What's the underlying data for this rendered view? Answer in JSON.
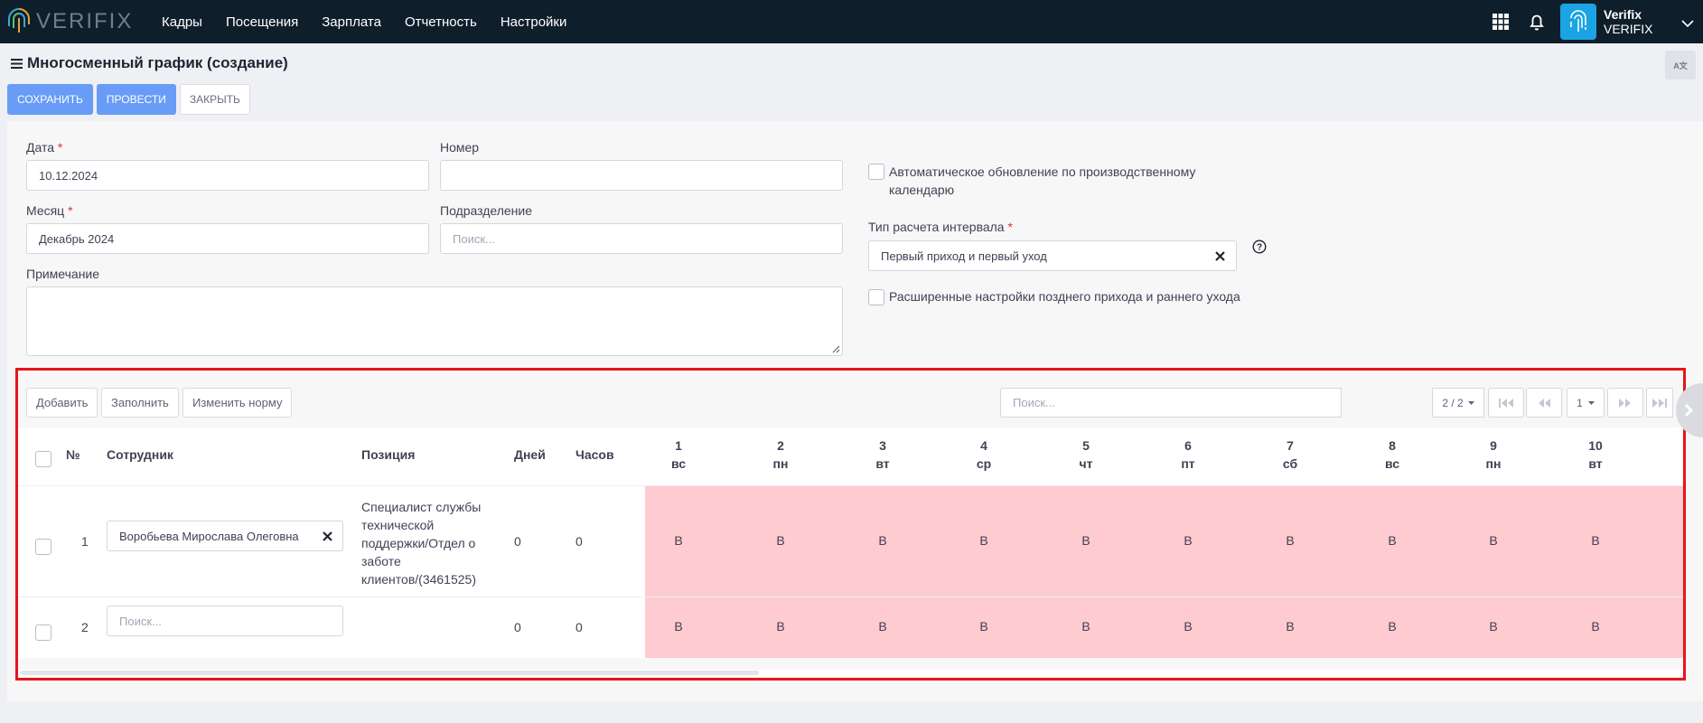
{
  "topbar": {
    "logo_text": "VERIFIX",
    "nav": [
      "Кадры",
      "Посещения",
      "Зарплата",
      "Отчетность",
      "Настройки"
    ],
    "user": {
      "name": "Verifix",
      "org": "VERIFIX"
    }
  },
  "page": {
    "title": "Многосменный график (создание)",
    "lang_badge": "A文"
  },
  "actions": {
    "save": "СОХРАНИТЬ",
    "post": "ПРОВЕСТИ",
    "close": "ЗАКРЫТЬ"
  },
  "form": {
    "date_label": "Дата",
    "date_value": "10.12.2024",
    "number_label": "Номер",
    "number_value": "",
    "month_label": "Месяц",
    "month_value": "Декабрь 2024",
    "division_label": "Подразделение",
    "division_placeholder": "Поиск...",
    "note_label": "Примечание",
    "auto_update_label": "Автоматическое обновление по производственному календарю",
    "interval_label": "Тип расчета интервала",
    "interval_value": "Первый приход и первый уход",
    "advanced_label": "Расширенные настройки позднего прихода и раннего ухода"
  },
  "table": {
    "toolbar": {
      "add": "Добавить",
      "fill": "Заполнить",
      "change_norm": "Изменить норму",
      "search_placeholder": "Поиск...",
      "page_count": "2 / 2",
      "page_size": "1"
    },
    "headers": {
      "no": "№",
      "employee": "Сотрудник",
      "position": "Позиция",
      "days": "Дней",
      "hours": "Часов"
    },
    "days": [
      {
        "num": "1",
        "wd": "вс"
      },
      {
        "num": "2",
        "wd": "пн"
      },
      {
        "num": "3",
        "wd": "вт"
      },
      {
        "num": "4",
        "wd": "ср"
      },
      {
        "num": "5",
        "wd": "чт"
      },
      {
        "num": "6",
        "wd": "пт"
      },
      {
        "num": "7",
        "wd": "сб"
      },
      {
        "num": "8",
        "wd": "вс"
      },
      {
        "num": "9",
        "wd": "пн"
      },
      {
        "num": "10",
        "wd": "вт"
      }
    ],
    "rows": [
      {
        "no": "1",
        "employee": "Воробьева Мирослава Олеговна",
        "position_lines": [
          "Специалист службы",
          "технической",
          "поддержки/Отдел о",
          "заботе",
          "клиентов/(3461525)"
        ],
        "days": "0",
        "hours": "0",
        "cells": [
          "В",
          "В",
          "В",
          "В",
          "В",
          "В",
          "В",
          "В",
          "В",
          "В"
        ]
      },
      {
        "no": "2",
        "employee_placeholder": "Поиск...",
        "days": "0",
        "hours": "0",
        "cells": [
          "В",
          "В",
          "В",
          "В",
          "В",
          "В",
          "В",
          "В",
          "В",
          "В"
        ]
      }
    ]
  },
  "colors": {
    "topbar": "#0f1e2b",
    "primary_button": "#689cf6",
    "accent_fingerprint": "#1ba4e4",
    "day_off_cell": "#fecbd1",
    "highlight_border": "#e8141b"
  }
}
